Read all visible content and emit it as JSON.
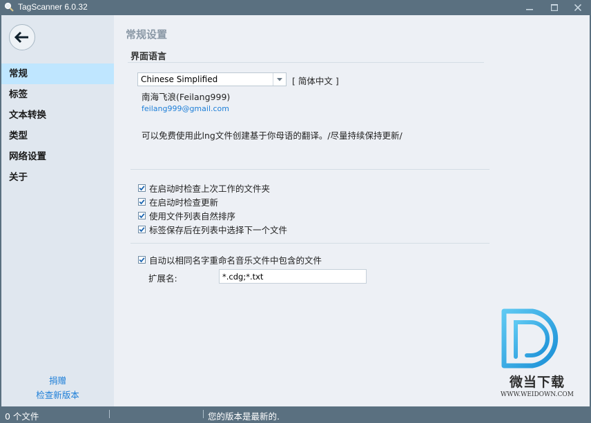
{
  "window": {
    "title": "TagScanner 6.0.32",
    "icons": {
      "app": "magnifier-icon",
      "minimize": "minimize-icon",
      "maximize": "maximize-icon",
      "close": "close-icon"
    }
  },
  "sidebar": {
    "back_icon": "arrow-left-icon",
    "items": [
      {
        "label": "常规",
        "active": true
      },
      {
        "label": "标签",
        "active": false
      },
      {
        "label": "文本转换",
        "active": false
      },
      {
        "label": "类型",
        "active": false
      },
      {
        "label": "网络设置",
        "active": false
      },
      {
        "label": "关于",
        "active": false
      }
    ],
    "links": {
      "donate": "捐赠",
      "check_update": "检查新版本"
    }
  },
  "main": {
    "page_title": "常规设置",
    "language_section": {
      "title": "界面语言",
      "selected_language": "Chinese Simplified",
      "native_name": "[ 简体中文 ]",
      "author": "南海飞浪(Feilang999)",
      "email": "feilang999@gmail.com",
      "note": "可以免费使用此lng文件创建基于你母语的翻译。/尽量持续保持更新/"
    },
    "options": [
      {
        "label": "在启动时检查上次工作的文件夹",
        "checked": true
      },
      {
        "label": "在启动时检查更新",
        "checked": true
      },
      {
        "label": "使用文件列表自然排序",
        "checked": true
      },
      {
        "label": "标签保存后在列表中选择下一个文件",
        "checked": true
      }
    ],
    "rename_option": {
      "label": "自动以相同名字重命名音乐文件中包含的文件",
      "checked": true
    },
    "extensions": {
      "label": "扩展名:",
      "value": "*.cdg;*.txt"
    }
  },
  "watermark": {
    "name": "微当下载",
    "url": "WWW.WEIDOWN.COM",
    "color": "#1ea0e6"
  },
  "statusbar": {
    "file_count": "0 个文件",
    "message": "您的版本是最新的."
  },
  "colors": {
    "titlebar": "#5a7080",
    "sidebar": "#e0e7ef",
    "active_item": "#bfe6ff",
    "content": "#edf0f5",
    "link": "#1e7fd8"
  }
}
